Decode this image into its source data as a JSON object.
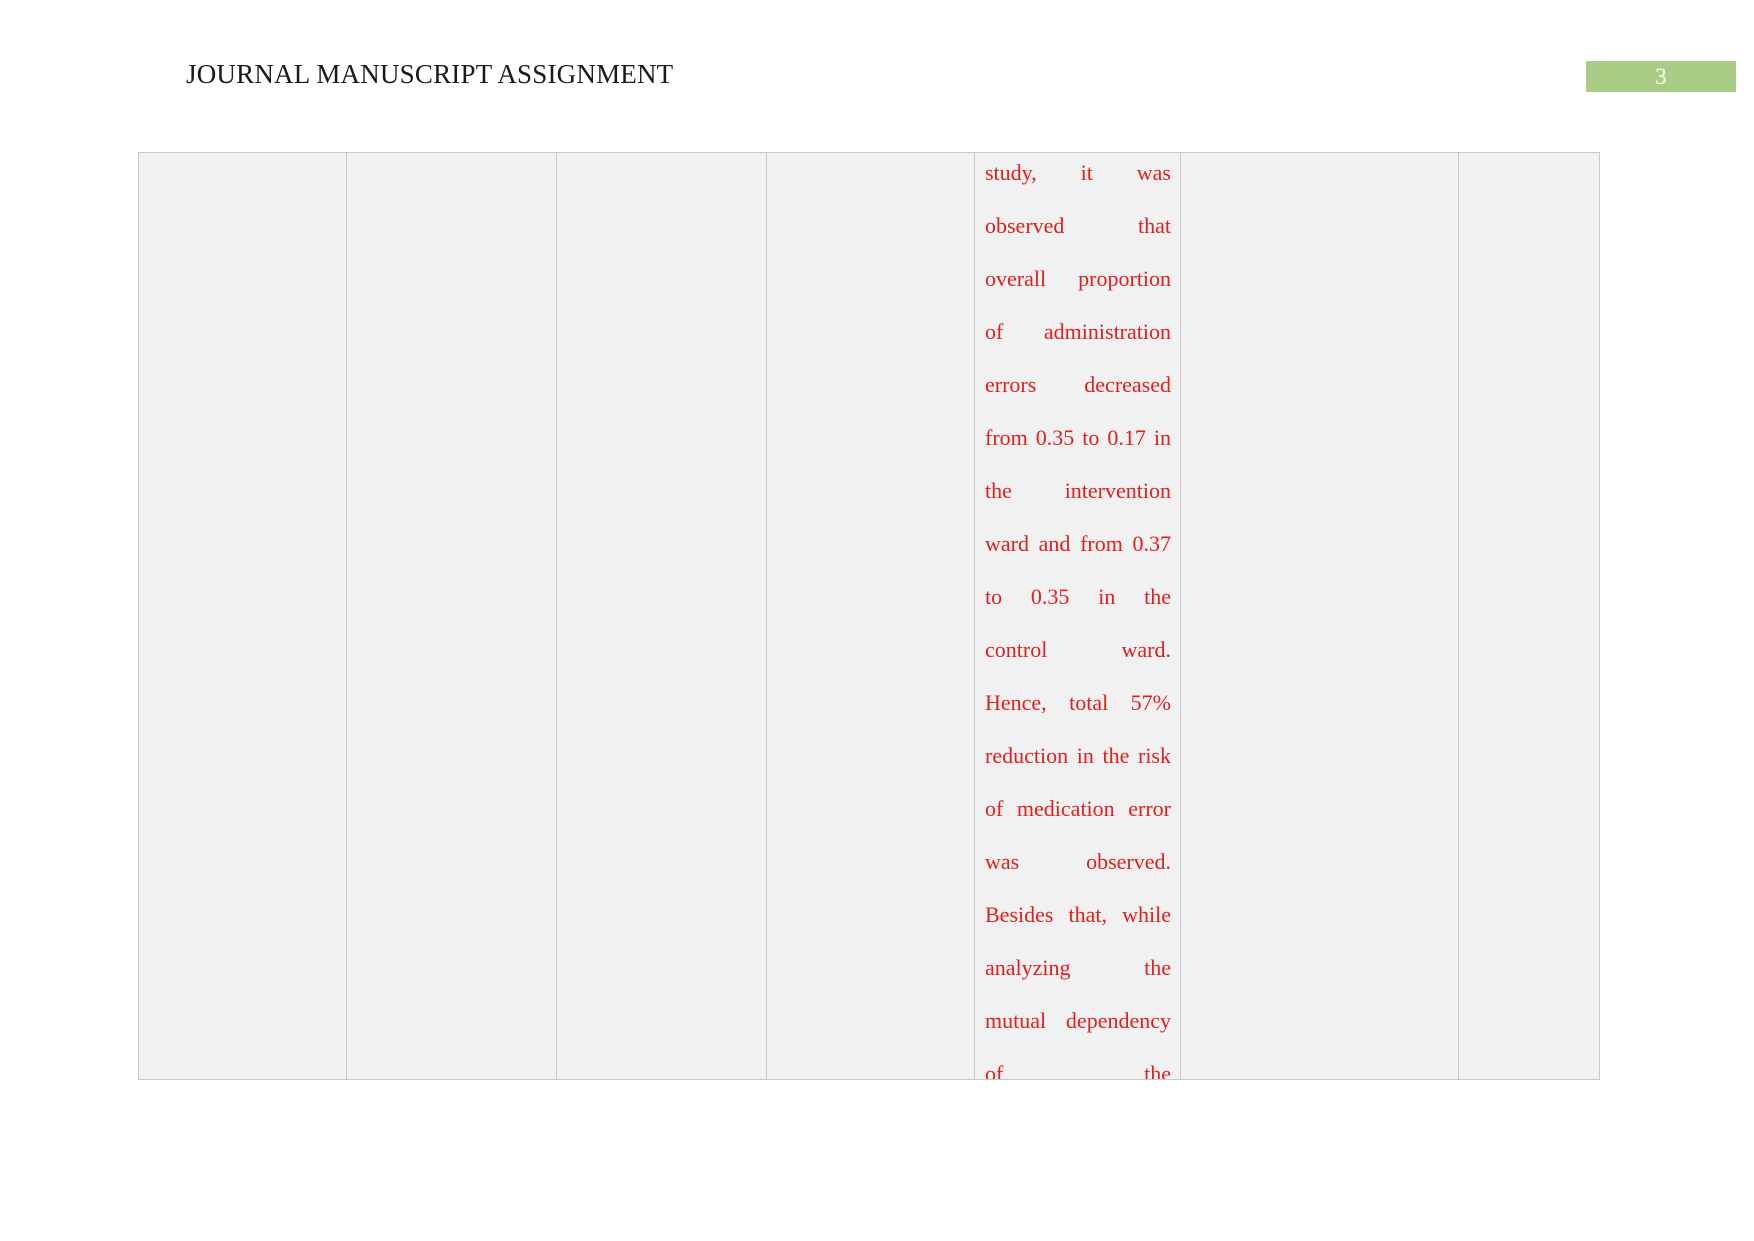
{
  "header": {
    "title": "JOURNAL MANUSCRIPT ASSIGNMENT",
    "page_number": "3",
    "badge_color": "#a9cc86",
    "badge_text_color": "#ffffff"
  },
  "table": {
    "column_count": 7,
    "row_count": 1,
    "cell_background": "#f1f1f1",
    "border_color": "#c8c8c8",
    "cells": [
      {
        "id": "cell-1",
        "text": ""
      },
      {
        "id": "cell-2",
        "text": ""
      },
      {
        "id": "cell-3",
        "text": ""
      },
      {
        "id": "cell-4",
        "text": ""
      },
      {
        "id": "cell-5",
        "text_color": "#e0201f",
        "text": "study, it was observed that overall proportion of administration errors decreased from 0.35 to 0.17 in the intervention ward and from 0.37 to 0.35 in the control ward. Hence, total 57% reduction in the risk of medication error was observed. Besides that, while analyzing the mutual dependency of the",
        "lines": [
          "study, it was",
          "observed that",
          "overall proportion",
          "of administration",
          "errors decreased",
          "from 0.35 to 0.17 in",
          "the intervention",
          "ward and from 0.37",
          "to 0.35 in the",
          "control ward.",
          "Hence, total 57%",
          "reduction in the risk",
          "of medication error",
          "was observed.",
          "Besides that, while",
          "analyzing the",
          "mutual dependency",
          "of the"
        ]
      },
      {
        "id": "cell-6",
        "text": ""
      },
      {
        "id": "cell-7",
        "text": ""
      }
    ]
  }
}
